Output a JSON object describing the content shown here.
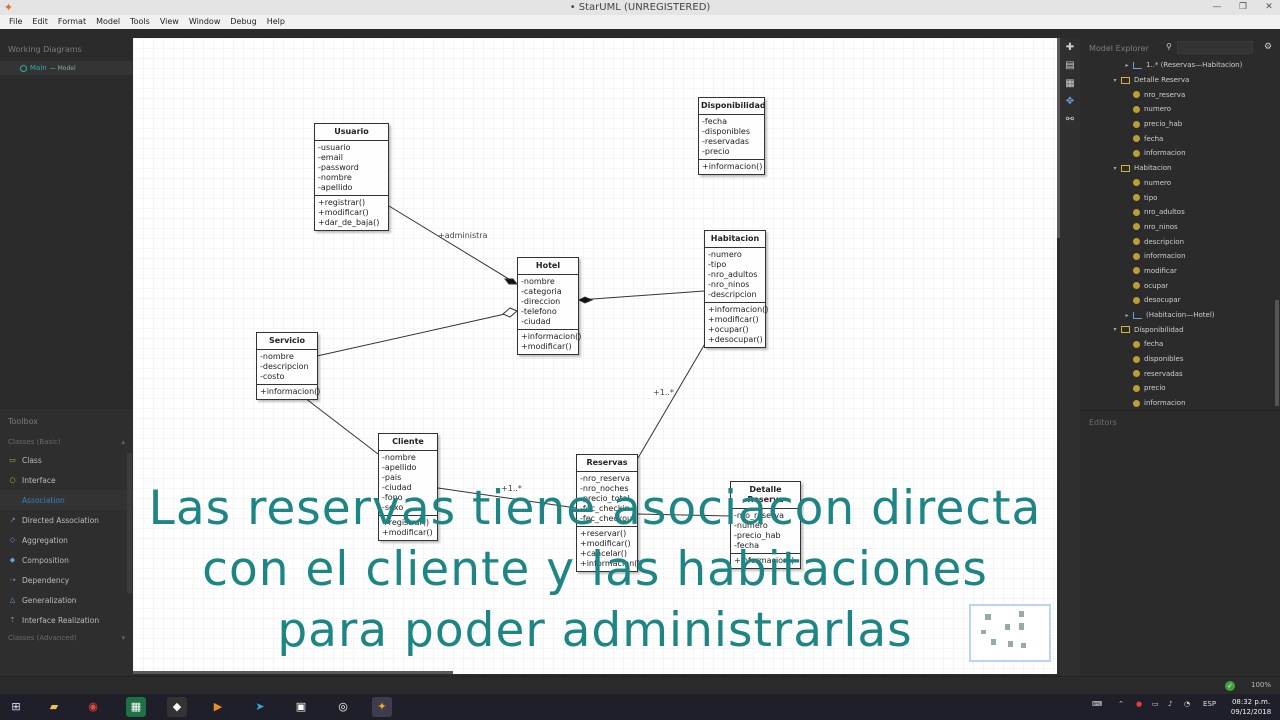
{
  "window": {
    "title": "• StarUML (UNREGISTERED)"
  },
  "menu": [
    "File",
    "Edit",
    "Format",
    "Model",
    "Tools",
    "View",
    "Window",
    "Debug",
    "Help"
  ],
  "working_diagrams": {
    "header": "Working Diagrams",
    "item_name": "Main",
    "item_suffix": "— Model"
  },
  "toolbox": {
    "header": "Toolbox",
    "group_basic": "Classes (Basic)",
    "items": [
      "Class",
      "Interface",
      "Association",
      "Directed Association",
      "Aggregation",
      "Composition",
      "Dependency",
      "Generalization",
      "Interface Realization"
    ],
    "group_advanced": "Classes (Advanced)"
  },
  "diagram": {
    "classes": {
      "usuario": {
        "name": "Usuario",
        "attributes": [
          "-usuario",
          "-email",
          "-password",
          "-nombre",
          "-apellido"
        ],
        "operations": [
          "+registrar()",
          "+modificar()",
          "+dar_de_baja()"
        ]
      },
      "disponibilidad": {
        "name": "Disponibilidad",
        "attributes": [
          "-fecha",
          "-disponibles",
          "-reservadas",
          "-precio"
        ],
        "operations": [
          "+informacion()"
        ]
      },
      "hotel": {
        "name": "Hotel",
        "attributes": [
          "-nombre",
          "-categoria",
          "-direccion",
          "-telefono",
          "-ciudad"
        ],
        "operations": [
          "+informacion()",
          "+modificar()"
        ]
      },
      "habitacion": {
        "name": "Habitacion",
        "attributes": [
          "-numero",
          "-tipo",
          "-nro_adultos",
          "-nro_ninos",
          "-descripcion"
        ],
        "operations": [
          "+informacion()",
          "+modificar()",
          "+ocupar()",
          "+desocupar()"
        ]
      },
      "servicio": {
        "name": "Servicio",
        "attributes": [
          "-nombre",
          "-descripcion",
          "-costo"
        ],
        "operations": [
          "+informacion()"
        ]
      },
      "cliente": {
        "name": "Cliente",
        "attributes": [
          "-nombre",
          "-apellido",
          "-pais",
          "-ciudad",
          "-fono",
          "-sexo"
        ],
        "operations": [
          "+registrar()",
          "+modificar()"
        ]
      },
      "reservas": {
        "name": "Reservas",
        "attributes": [
          "-nro_reserva",
          "-nro_noches",
          "-precio_total",
          "-fec_checkin",
          "-fec_checkout"
        ],
        "operations": [
          "+reservar()",
          "+modificar()",
          "+cancelar()",
          "+informacion()"
        ]
      },
      "detalle": {
        "name": "Detalle Reserva",
        "attributes": [
          "-nro_reserva",
          "-numero",
          "-precio_hab",
          "-fecha"
        ],
        "operations": [
          "+informacion()"
        ]
      }
    },
    "labels": {
      "administra": "+administra",
      "mult_habitacion": "+1..*",
      "mult_cliente": "+1..*"
    }
  },
  "caption": {
    "line1": "Las reservas tiene asociacon directa",
    "line2": "con el cliente y las habitaciones",
    "line3": "para poder administrarlas"
  },
  "explorer": {
    "header": "Model Explorer",
    "rows": [
      {
        "level": 2,
        "kind": "link",
        "twisty": "▸",
        "text": "1..* (Reservas—Habitacion)"
      },
      {
        "level": 1,
        "kind": "class",
        "twisty": "▾",
        "text": "Detalle Reserva"
      },
      {
        "level": 2,
        "kind": "attr",
        "twisty": "",
        "text": "nro_reserva"
      },
      {
        "level": 2,
        "kind": "attr",
        "twisty": "",
        "text": "numero"
      },
      {
        "level": 2,
        "kind": "attr",
        "twisty": "",
        "text": "precio_hab"
      },
      {
        "level": 2,
        "kind": "attr",
        "twisty": "",
        "text": "fecha"
      },
      {
        "level": 2,
        "kind": "attr",
        "twisty": "",
        "text": "informacion"
      },
      {
        "level": 1,
        "kind": "class",
        "twisty": "▾",
        "text": "Habitacion"
      },
      {
        "level": 2,
        "kind": "attr",
        "twisty": "",
        "text": "numero"
      },
      {
        "level": 2,
        "kind": "attr",
        "twisty": "",
        "text": "tipo"
      },
      {
        "level": 2,
        "kind": "attr",
        "twisty": "",
        "text": "nro_adultos"
      },
      {
        "level": 2,
        "kind": "attr",
        "twisty": "",
        "text": "nro_ninos"
      },
      {
        "level": 2,
        "kind": "attr",
        "twisty": "",
        "text": "descripcion"
      },
      {
        "level": 2,
        "kind": "attr",
        "twisty": "",
        "text": "informacion"
      },
      {
        "level": 2,
        "kind": "attr",
        "twisty": "",
        "text": "modificar"
      },
      {
        "level": 2,
        "kind": "attr",
        "twisty": "",
        "text": "ocupar"
      },
      {
        "level": 2,
        "kind": "attr",
        "twisty": "",
        "text": "desocupar"
      },
      {
        "level": 2,
        "kind": "link",
        "twisty": "▸",
        "text": "(Habitacion—Hotel)"
      },
      {
        "level": 1,
        "kind": "class",
        "twisty": "▾",
        "text": "Disponibilidad"
      },
      {
        "level": 2,
        "kind": "attr",
        "twisty": "",
        "text": "fecha"
      },
      {
        "level": 2,
        "kind": "attr",
        "twisty": "",
        "text": "disponibles"
      },
      {
        "level": 2,
        "kind": "attr",
        "twisty": "",
        "text": "reservadas"
      },
      {
        "level": 2,
        "kind": "attr",
        "twisty": "",
        "text": "precio"
      },
      {
        "level": 2,
        "kind": "attr",
        "twisty": "",
        "text": "informacion"
      }
    ]
  },
  "editors": {
    "header": "Editors"
  },
  "status": {
    "zoom": "100%"
  },
  "taskbar": {
    "language": "ESP",
    "time": "08:32 p.m.",
    "date": "09/12/2018",
    "apps": [
      "windows-start",
      "file-explorer",
      "chrome",
      "excel",
      "nox",
      "media-player",
      "telegram",
      "app-window",
      "obs",
      "staruml"
    ]
  },
  "colors": {
    "caption": "#1e8585",
    "canvas": "#ffffff",
    "panel": "#2b2b2b",
    "accent": "#3a7fc0"
  }
}
